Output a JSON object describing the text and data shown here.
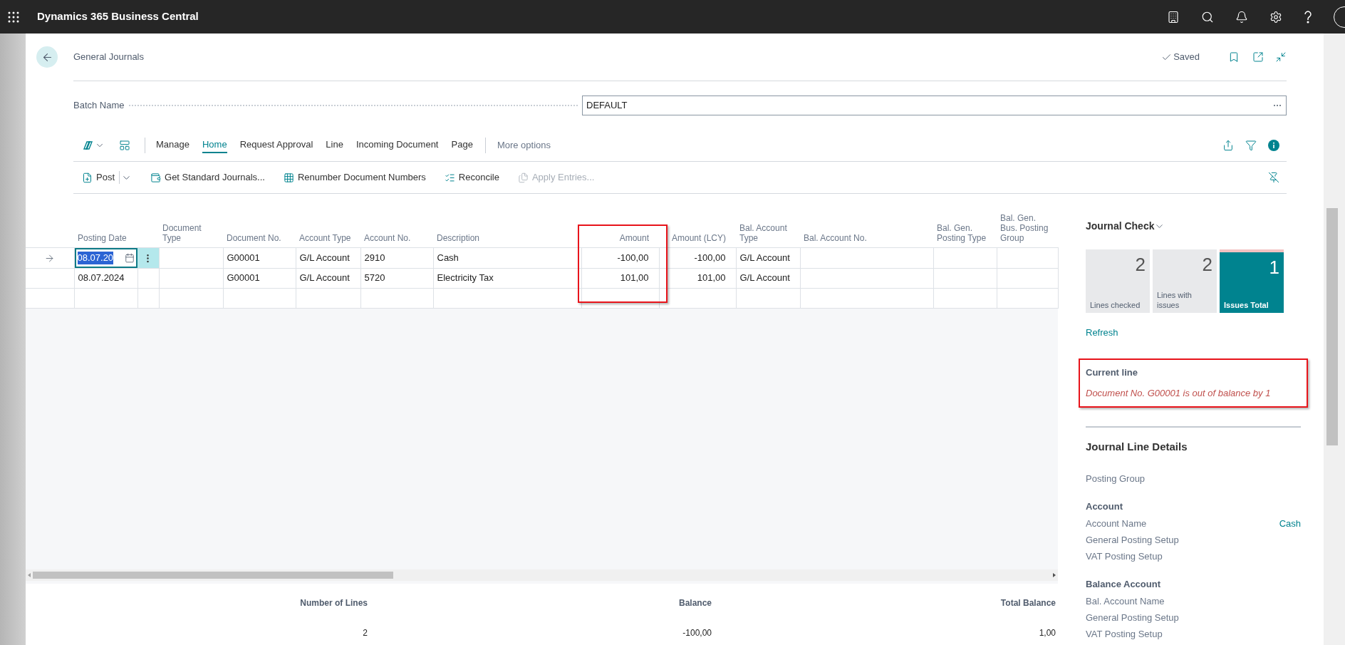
{
  "app_bar": {
    "title": "Dynamics 365 Business Central"
  },
  "page": {
    "title": "General Journals",
    "save_status": "Saved"
  },
  "batch": {
    "label": "Batch Name",
    "value": "DEFAULT"
  },
  "menu_tabs": [
    {
      "label": "Manage",
      "selected": false
    },
    {
      "label": "Home",
      "selected": true
    },
    {
      "label": "Request Approval",
      "selected": false
    },
    {
      "label": "Line",
      "selected": false
    },
    {
      "label": "Incoming Document",
      "selected": false
    },
    {
      "label": "Page",
      "selected": false
    }
  ],
  "more_options": "More options",
  "actions": [
    {
      "label": "Post",
      "disabled": false,
      "dropdown": true
    },
    {
      "label": "Get Standard Journals...",
      "disabled": false,
      "dropdown": false
    },
    {
      "label": "Renumber Document Numbers",
      "disabled": false,
      "dropdown": false
    },
    {
      "label": "Reconcile",
      "disabled": false,
      "dropdown": false
    },
    {
      "label": "Apply Entries...",
      "disabled": true,
      "dropdown": false
    }
  ],
  "table": {
    "columns": [
      {
        "label": "Posting Date",
        "numeric": false,
        "highlighted": false
      },
      {
        "label": "Document Type",
        "numeric": false,
        "highlighted": false
      },
      {
        "label": "Document No.",
        "numeric": false,
        "highlighted": false
      },
      {
        "label": "Account Type",
        "numeric": false,
        "highlighted": false
      },
      {
        "label": "Account No.",
        "numeric": false,
        "highlighted": false
      },
      {
        "label": "Description",
        "numeric": false,
        "highlighted": false
      },
      {
        "label": "Amount",
        "numeric": true,
        "highlighted": true
      },
      {
        "label": "Amount (LCY)",
        "numeric": true,
        "highlighted": false
      },
      {
        "label": "Bal. Account Type",
        "numeric": false,
        "highlighted": false
      },
      {
        "label": "Bal. Account No.",
        "numeric": false,
        "highlighted": false
      },
      {
        "label": "Bal. Gen. Posting Type",
        "numeric": false,
        "highlighted": false
      },
      {
        "label": "Bal. Gen. Bus. Posting Group",
        "numeric": false,
        "highlighted": false
      }
    ],
    "rows": [
      {
        "selected": true,
        "cells": [
          "08.07.20",
          null,
          "G00001",
          "G/L Account",
          "2910",
          "Cash",
          "-100,00",
          "-100,00",
          "G/L Account",
          null,
          null,
          null
        ]
      },
      {
        "selected": false,
        "cells": [
          "08.07.2024",
          null,
          "G00001",
          "G/L Account",
          "5720",
          "Electricity Tax",
          "101,00",
          "101,00",
          "G/L Account",
          null,
          null,
          null
        ]
      }
    ]
  },
  "totals": [
    {
      "label": "Number of Lines",
      "value": "2"
    },
    {
      "label": "Balance",
      "value": "-100,00"
    },
    {
      "label": "Total Balance",
      "value": "1,00"
    }
  ],
  "journal_check": {
    "title": "Journal Check",
    "tiles": [
      {
        "value": "2",
        "label": "Lines checked",
        "kind": "neutral"
      },
      {
        "value": "2",
        "label": "Lines with issues",
        "kind": "neutral"
      },
      {
        "value": "1",
        "label": "Issues Total",
        "kind": "alert"
      }
    ],
    "refresh": "Refresh",
    "current_line": {
      "title": "Current line",
      "message": "Document No. G00001 is out of balance by 1",
      "highlighted": true
    }
  },
  "details": {
    "title": "Journal Line Details",
    "groups": [
      {
        "fields": [
          {
            "label": "Posting Group"
          }
        ]
      },
      {
        "heading": "Account",
        "fields": [
          {
            "label": "Account Name",
            "value": "Cash"
          },
          {
            "label": "General Posting Setup"
          },
          {
            "label": "VAT Posting Setup"
          }
        ]
      },
      {
        "heading": "Balance Account",
        "fields": [
          {
            "label": "Bal. Account Name"
          },
          {
            "label": "General Posting Setup"
          },
          {
            "label": "VAT Posting Setup"
          }
        ]
      }
    ]
  }
}
